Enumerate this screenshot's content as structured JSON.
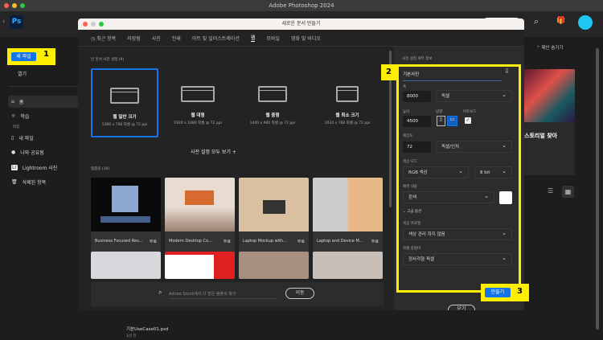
{
  "app_title": "Adobe Photoshop 2024",
  "logo": "Ps",
  "sidebar": {
    "new_file": "새 파일",
    "open": "열기",
    "items": [
      {
        "label": "홈",
        "icon": "home-icon"
      },
      {
        "label": "학습",
        "icon": "lightbulb-icon"
      }
    ],
    "section": "파일",
    "file_items": [
      {
        "label": "내 파일",
        "icon": "file-icon"
      },
      {
        "label": "나와 공유됨",
        "icon": "user-icon"
      },
      {
        "label": "Lightroom 사진",
        "icon": "lightroom-icon"
      },
      {
        "label": "삭제된 항목",
        "icon": "trash-icon"
      }
    ]
  },
  "callouts": [
    "1",
    "2",
    "3"
  ],
  "dialog": {
    "title": "새로운 문서 만들기",
    "tabs": [
      "최근 항목",
      "저장됨",
      "사진",
      "인쇄",
      "아트 및 일러스트레이션",
      "웹",
      "모바일",
      "영화 및 비디오"
    ],
    "active_tab": "웹",
    "presets_heading": "빈 문서 사전 설정 (9)",
    "presets": [
      {
        "name": "웹 일반 크기",
        "dims": "1366 x 768 픽셀 @ 72 ppi"
      },
      {
        "name": "웹 대형",
        "dims": "1920 x 1080 픽셀 @ 72 ppi"
      },
      {
        "name": "웹 중형",
        "dims": "1440 x 900 픽셀 @ 72 ppi"
      },
      {
        "name": "웹 최소 크기",
        "dims": "1024 x 768 픽셀 @ 72 ppi"
      }
    ],
    "view_all": "사전 설정 모두 보기 +",
    "templates_heading": "템플릿 (16)",
    "templates": [
      {
        "name": "Business Focused Res...",
        "badge": "무료"
      },
      {
        "name": "Modern Desktop Co...",
        "badge": "무료"
      },
      {
        "name": "Laptop Mockup with...",
        "badge": "무료"
      },
      {
        "name": "Laptop and Device M...",
        "badge": "무료"
      }
    ],
    "stock_search": "Adobe Stock에서 더 많은 템플릿 찾기",
    "go_button": "이동",
    "details": {
      "heading": "사전 설정 세부 정보",
      "name": "기본사진",
      "width_label": "폭",
      "width": "8000",
      "width_unit": "픽셀",
      "height_label": "높이",
      "height": "4500",
      "orientation_label": "방향",
      "artboard_label": "아트보드",
      "resolution_label": "해상도",
      "resolution": "72",
      "resolution_unit": "픽셀/인치",
      "color_mode_label": "색상 모드",
      "color_mode": "RGB 색상",
      "bit_depth": "8 bit",
      "background_label": "배경 내용",
      "background": "흰색",
      "background_color": "#ffffff",
      "advanced": "고급 옵션",
      "profile_label": "색상 프로필",
      "profile": "색상 관리 하지 않음",
      "pixel_aspect_label": "픽셀 종횡비",
      "pixel_aspect": "정사각형 픽셀"
    },
    "close_button": "닫기",
    "create_button": "만들기"
  },
  "right": {
    "hide_suggestions": "제안 숨기기",
    "tutorial_text": "스토리얼 찾아"
  },
  "recent_file": {
    "name": "기본UseCase01.psd",
    "meta": "1년 전"
  }
}
